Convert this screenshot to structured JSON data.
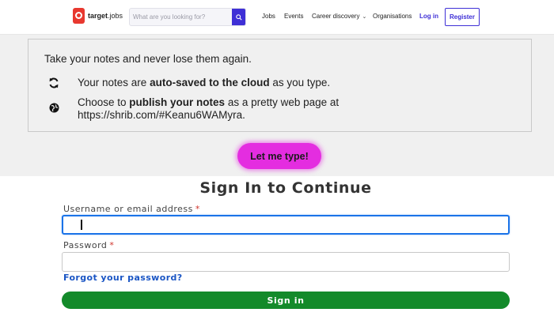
{
  "topnav": {
    "logo_brand": "target",
    "logo_suffix": "jobs",
    "search_placeholder": "What are you looking for?",
    "search_icon": "search-icon",
    "links": {
      "jobs": "Jobs",
      "events": "Events",
      "career": "Career discovery",
      "organisations": "Organisations",
      "login": "Log in",
      "register": "Register"
    },
    "accent_color": "#3e2fd6"
  },
  "notes": {
    "heading": "Take your notes and never lose them again.",
    "row1": {
      "icon": "sync-icon",
      "prefix": "Your notes are ",
      "bold": "auto-saved to the cloud",
      "suffix": " as you type."
    },
    "row2": {
      "icon": "globe-icon",
      "prefix": "Choose to ",
      "bold": "publish your notes",
      "suffix": " as a pretty web page at",
      "line2": "https://shrib.com/#Keanu6WAMyra."
    },
    "type_button": "Let me type!",
    "type_button_color": "#e42de0"
  },
  "signin": {
    "title": "Sign In to Continue",
    "username_label": "Username or email address",
    "username_value": "",
    "password_label": "Password",
    "password_value": "",
    "required_mark": "*",
    "forgot_link": "Forgot your password?",
    "submit": "Sign in",
    "submit_color": "#138a2a"
  }
}
